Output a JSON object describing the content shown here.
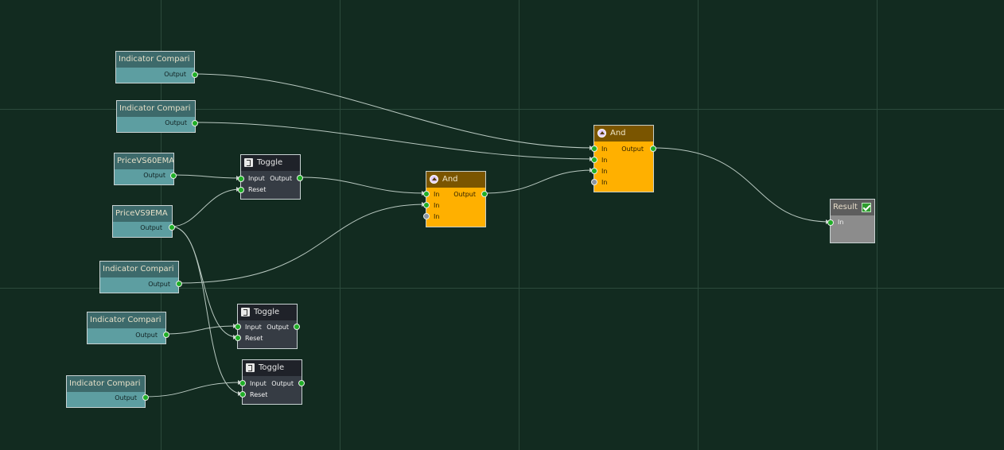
{
  "nodes": {
    "indicator_1": {
      "title": "Indicator Compari",
      "output_label": "Output"
    },
    "indicator_2": {
      "title": "Indicator Compari",
      "output_label": "Output"
    },
    "price_vs_60ema": {
      "title": "PriceVS60EMA",
      "output_label": "Output"
    },
    "price_vs_9ema": {
      "title": "PriceVS9EMA",
      "output_label": "Output"
    },
    "indicator_3": {
      "title": "Indicator Compari",
      "output_label": "Output"
    },
    "indicator_4": {
      "title": "Indicator Compari",
      "output_label": "Output"
    },
    "indicator_5": {
      "title": "Indicator Compari",
      "output_label": "Output"
    },
    "toggle_1": {
      "title": "Toggle",
      "input_label": "Input",
      "reset_label": "Reset",
      "output_label": "Output"
    },
    "toggle_2": {
      "title": "Toggle",
      "input_label": "Input",
      "reset_label": "Reset",
      "output_label": "Output"
    },
    "toggle_3": {
      "title": "Toggle",
      "input_label": "Input",
      "reset_label": "Reset",
      "output_label": "Output"
    },
    "and_1": {
      "title": "And",
      "in_label": "In",
      "output_label": "Output"
    },
    "and_2": {
      "title": "And",
      "in_label": "In",
      "output_label": "Output"
    },
    "result": {
      "title": "Result",
      "in_label": "In"
    }
  },
  "colors": {
    "canvas": "#122b20",
    "indicator_body": "#5d9ea1",
    "toggle_body": "#363c44",
    "and_body": "#ffb000",
    "result_body": "#8c8c8c",
    "port_connected": "#1fae26",
    "port_empty": "#8a93a0",
    "wire": "#b8c8c0"
  },
  "icons": {
    "toggle": "toggle-icon",
    "and": "and-icon",
    "result": "check-icon"
  }
}
